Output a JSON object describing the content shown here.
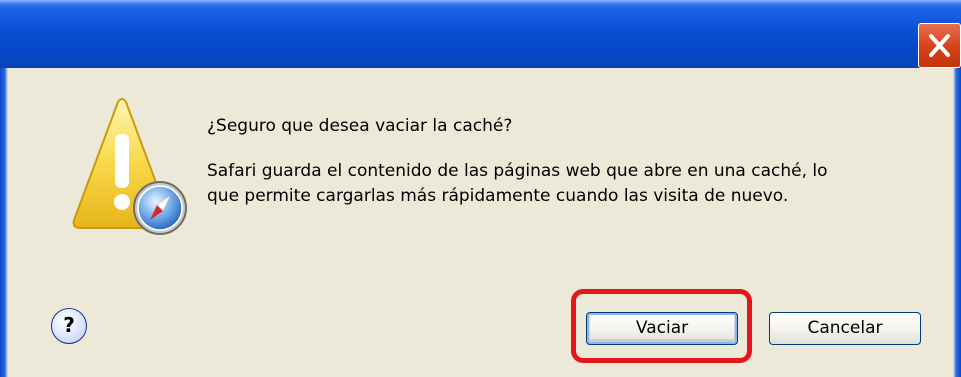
{
  "window": {
    "title": "",
    "close_icon": "close-icon"
  },
  "message": {
    "icon": "warning-safari-icon",
    "headline": "¿Seguro que desea vaciar la caché?",
    "body_line1": "Safari guarda el contenido de las páginas web que abre en una caché, lo",
    "body_line2": "que permite cargarlas más rápidamente cuando las visita de nuevo."
  },
  "footer": {
    "help_label": "?",
    "primary_button": "Vaciar",
    "secondary_button": "Cancelar"
  },
  "annotation": {
    "highlight_color": "#e4151c"
  },
  "colors": {
    "title_bar": "#0a4fd6",
    "dialog_bg": "#ece9d8",
    "close_button": "#d64018"
  }
}
